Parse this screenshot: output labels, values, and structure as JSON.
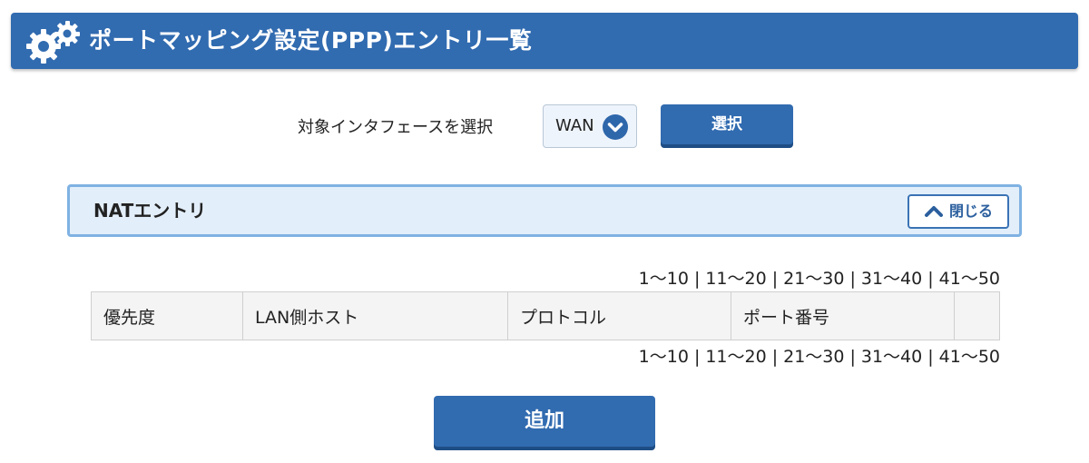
{
  "header": {
    "title": "ポートマッピング設定(PPP)エントリ一覧",
    "icon": "gears-icon"
  },
  "interface_select": {
    "label": "対象インタフェースを選択",
    "value": "WAN",
    "button_label": "選択"
  },
  "nat_panel": {
    "title": "NATエントリ",
    "close_label": "閉じる"
  },
  "pagination": {
    "pages": [
      "1〜10",
      "11〜20",
      "21〜30",
      "31〜40",
      "41〜50"
    ],
    "separator": "|"
  },
  "table": {
    "columns": [
      "優先度",
      "LAN側ホスト",
      "プロトコル",
      "ポート番号",
      ""
    ]
  },
  "add_button": {
    "label": "追加"
  },
  "colors": {
    "brand": "#316bb0",
    "panel_bg": "#e2eefa",
    "panel_border": "#7fb2e3"
  }
}
